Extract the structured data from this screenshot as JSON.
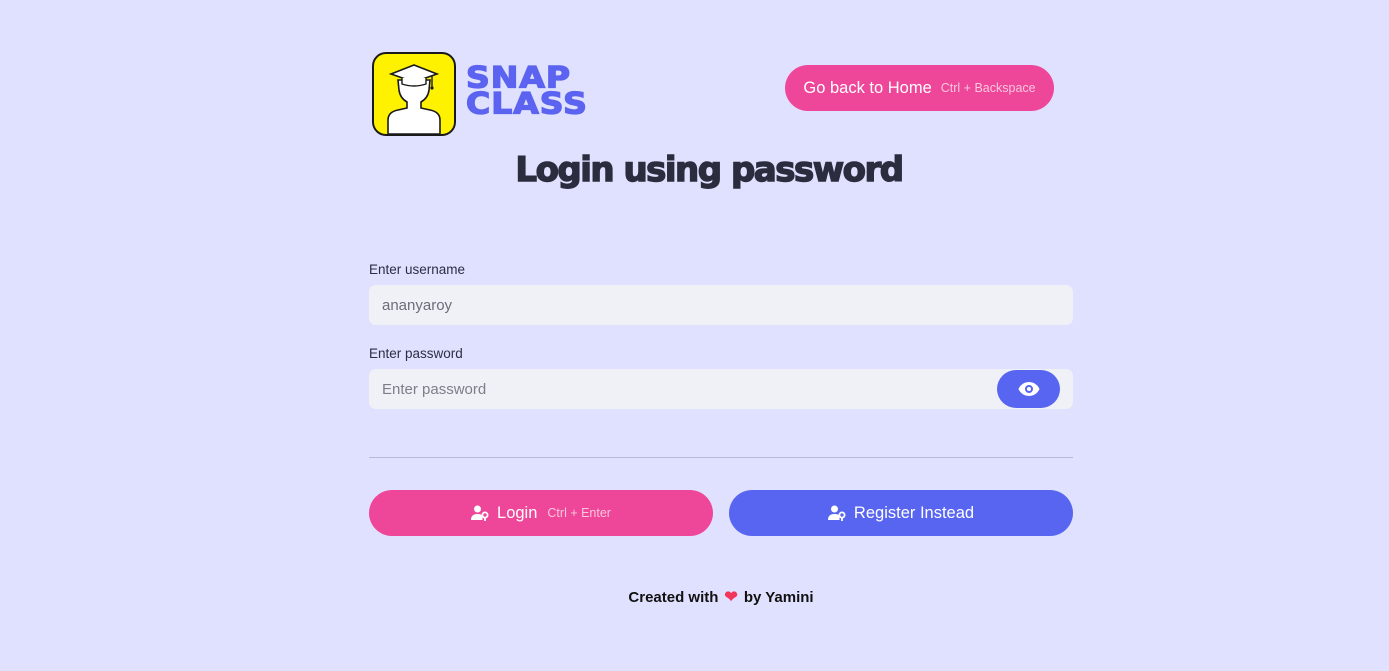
{
  "brand": {
    "logo_line1": "SNAP",
    "logo_line2": "CLASS"
  },
  "header": {
    "home_button_label": "Go back to Home",
    "home_button_shortcut": "Ctrl + Backspace"
  },
  "title": "Login using password",
  "form": {
    "username": {
      "label": "Enter username",
      "value": "ananyaroy"
    },
    "password": {
      "label": "Enter password",
      "placeholder": "Enter password",
      "value": ""
    }
  },
  "actions": {
    "login_label": "Login",
    "login_shortcut": "Ctrl + Enter",
    "register_label": "Register Instead"
  },
  "footer": {
    "prefix": "Created with",
    "heart": "❤",
    "suffix": "by Yamini"
  },
  "colors": {
    "background": "#e0e1fe",
    "pink": "#ee4699",
    "indigo": "#5865f0",
    "logo_yellow": "#fff200"
  }
}
